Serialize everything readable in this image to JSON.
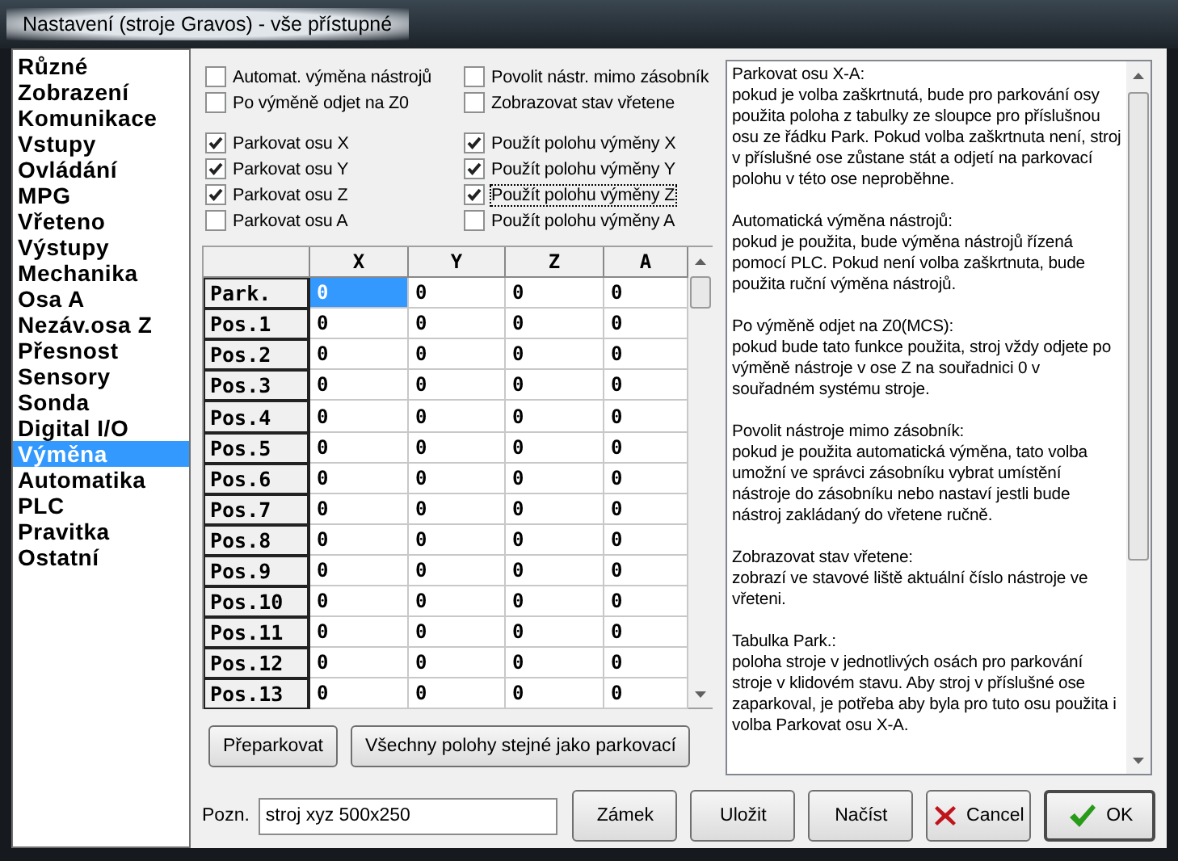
{
  "window": {
    "title": "Nastavení (stroje Gravos) - vše přístupné"
  },
  "sidebar": {
    "items": [
      {
        "label": "Různé",
        "selected": false
      },
      {
        "label": "Zobrazení",
        "selected": false
      },
      {
        "label": "Komunikace",
        "selected": false
      },
      {
        "label": "Vstupy",
        "selected": false
      },
      {
        "label": "Ovládání",
        "selected": false
      },
      {
        "label": "MPG",
        "selected": false
      },
      {
        "label": "Vřeteno",
        "selected": false
      },
      {
        "label": "Výstupy",
        "selected": false
      },
      {
        "label": "Mechanika",
        "selected": false
      },
      {
        "label": "Osa A",
        "selected": false
      },
      {
        "label": "Nezáv.osa Z",
        "selected": false
      },
      {
        "label": "Přesnost",
        "selected": false
      },
      {
        "label": "Sensory",
        "selected": false
      },
      {
        "label": "Sonda",
        "selected": false
      },
      {
        "label": "Digital I/O",
        "selected": false
      },
      {
        "label": "Výměna",
        "selected": true
      },
      {
        "label": "Automatika",
        "selected": false
      },
      {
        "label": "PLC",
        "selected": false
      },
      {
        "label": "Pravitka",
        "selected": false
      },
      {
        "label": "Ostatní",
        "selected": false
      }
    ]
  },
  "options": [
    [
      {
        "label": "Automat. výměna nástrojů",
        "checked": false,
        "focused": false
      },
      {
        "label": "Povolit nástr. mimo zásobník",
        "checked": false,
        "focused": false
      }
    ],
    [
      {
        "label": "Po výměně odjet na Z0",
        "checked": false,
        "focused": false
      },
      {
        "label": "Zobrazovat stav vřetene",
        "checked": false,
        "focused": false
      }
    ]
  ],
  "axis_options": [
    [
      {
        "label": "Parkovat osu X",
        "checked": true,
        "focused": false
      },
      {
        "label": "Použít polohu výměny X",
        "checked": true,
        "focused": false
      }
    ],
    [
      {
        "label": "Parkovat osu Y",
        "checked": true,
        "focused": false
      },
      {
        "label": "Použít polohu výměny Y",
        "checked": true,
        "focused": false
      }
    ],
    [
      {
        "label": "Parkovat osu Z",
        "checked": true,
        "focused": false
      },
      {
        "label": "Použít polohu výměny Z",
        "checked": true,
        "focused": true
      }
    ],
    [
      {
        "label": "Parkovat osu A",
        "checked": false,
        "focused": false
      },
      {
        "label": "Použít polohu výměny A",
        "checked": false,
        "focused": false
      }
    ]
  ],
  "table": {
    "columns": [
      "X",
      "Y",
      "Z",
      "A"
    ],
    "rows": [
      {
        "label": "Park.",
        "cells": [
          {
            "value": "0",
            "selected": true
          },
          {
            "value": "0",
            "selected": false
          },
          {
            "value": "0",
            "selected": false
          },
          {
            "value": "0",
            "selected": false
          }
        ]
      },
      {
        "label": "Pos.1",
        "cells": [
          {
            "value": "0",
            "selected": false
          },
          {
            "value": "0",
            "selected": false
          },
          {
            "value": "0",
            "selected": false
          },
          {
            "value": "0",
            "selected": false
          }
        ]
      },
      {
        "label": "Pos.2",
        "cells": [
          {
            "value": "0",
            "selected": false
          },
          {
            "value": "0",
            "selected": false
          },
          {
            "value": "0",
            "selected": false
          },
          {
            "value": "0",
            "selected": false
          }
        ]
      },
      {
        "label": "Pos.3",
        "cells": [
          {
            "value": "0",
            "selected": false
          },
          {
            "value": "0",
            "selected": false
          },
          {
            "value": "0",
            "selected": false
          },
          {
            "value": "0",
            "selected": false
          }
        ]
      },
      {
        "label": "Pos.4",
        "cells": [
          {
            "value": "0",
            "selected": false
          },
          {
            "value": "0",
            "selected": false
          },
          {
            "value": "0",
            "selected": false
          },
          {
            "value": "0",
            "selected": false
          }
        ]
      },
      {
        "label": "Pos.5",
        "cells": [
          {
            "value": "0",
            "selected": false
          },
          {
            "value": "0",
            "selected": false
          },
          {
            "value": "0",
            "selected": false
          },
          {
            "value": "0",
            "selected": false
          }
        ]
      },
      {
        "label": "Pos.6",
        "cells": [
          {
            "value": "0",
            "selected": false
          },
          {
            "value": "0",
            "selected": false
          },
          {
            "value": "0",
            "selected": false
          },
          {
            "value": "0",
            "selected": false
          }
        ]
      },
      {
        "label": "Pos.7",
        "cells": [
          {
            "value": "0",
            "selected": false
          },
          {
            "value": "0",
            "selected": false
          },
          {
            "value": "0",
            "selected": false
          },
          {
            "value": "0",
            "selected": false
          }
        ]
      },
      {
        "label": "Pos.8",
        "cells": [
          {
            "value": "0",
            "selected": false
          },
          {
            "value": "0",
            "selected": false
          },
          {
            "value": "0",
            "selected": false
          },
          {
            "value": "0",
            "selected": false
          }
        ]
      },
      {
        "label": "Pos.9",
        "cells": [
          {
            "value": "0",
            "selected": false
          },
          {
            "value": "0",
            "selected": false
          },
          {
            "value": "0",
            "selected": false
          },
          {
            "value": "0",
            "selected": false
          }
        ]
      },
      {
        "label": "Pos.10",
        "cells": [
          {
            "value": "0",
            "selected": false
          },
          {
            "value": "0",
            "selected": false
          },
          {
            "value": "0",
            "selected": false
          },
          {
            "value": "0",
            "selected": false
          }
        ]
      },
      {
        "label": "Pos.11",
        "cells": [
          {
            "value": "0",
            "selected": false
          },
          {
            "value": "0",
            "selected": false
          },
          {
            "value": "0",
            "selected": false
          },
          {
            "value": "0",
            "selected": false
          }
        ]
      },
      {
        "label": "Pos.12",
        "cells": [
          {
            "value": "0",
            "selected": false
          },
          {
            "value": "0",
            "selected": false
          },
          {
            "value": "0",
            "selected": false
          },
          {
            "value": "0",
            "selected": false
          }
        ]
      },
      {
        "label": "Pos.13",
        "cells": [
          {
            "value": "0",
            "selected": false
          },
          {
            "value": "0",
            "selected": false
          },
          {
            "value": "0",
            "selected": false
          },
          {
            "value": "0",
            "selected": false
          }
        ]
      }
    ]
  },
  "table_buttons": [
    "Přeparkovat",
    "Všechny polohy stejné jako parkovací"
  ],
  "help": [
    {
      "title": "Parkovat osu X-A:",
      "text": "pokud je volba zaškrtnutá, bude pro parkování osy použita poloha z tabulky ze sloupce pro příslušnou osu ze řádku Park. Pokud volba zaškrtnuta není, stroj v příslušné ose zůstane stát a odjetí na parkovací polohu v této ose neproběhne."
    },
    {
      "title": "Automatická výměna nástrojů:",
      "text": "pokud je použita, bude výměna nástrojů řízená pomocí PLC. Pokud není volba zaškrtnuta, bude použita ruční výměna nástrojů."
    },
    {
      "title": "Po výměně odjet na Z0(MCS):",
      "text": "pokud bude tato funkce použita, stroj vždy odjete po výměně nástroje v ose Z na souřadnici 0 v souřadném systému stroje."
    },
    {
      "title": "Povolit nástroje mimo zásobník:",
      "text": "pokud je použita automatická výměna, tato volba umožní ve správci zásobníku vybrat umístění nástroje do zásobníku nebo nastaví jestli bude nástroj zakládaný do vřetene ručně."
    },
    {
      "title": "Zobrazovat stav vřetene:",
      "text": "zobrazí ve stavové liště aktuální číslo nástroje ve vřeteni."
    },
    {
      "title": "Tabulka Park.:",
      "text": "poloha stroje v jednotlivých osách pro parkování stroje v klidovém stavu. Aby stroj v příslušné ose zaparkoval, je potřeba aby byla pro tuto osu použita i volba Parkovat osu X-A."
    }
  ],
  "note": {
    "label": "Pozn.",
    "value": "stroj xyz 500x250"
  },
  "buttons": [
    {
      "label": "Zámek",
      "kind": "plain"
    },
    {
      "label": "Uložit",
      "kind": "plain"
    },
    {
      "label": "Načíst",
      "kind": "plain"
    },
    {
      "label": "Cancel",
      "kind": "cancel"
    },
    {
      "label": "OK",
      "kind": "ok"
    }
  ]
}
